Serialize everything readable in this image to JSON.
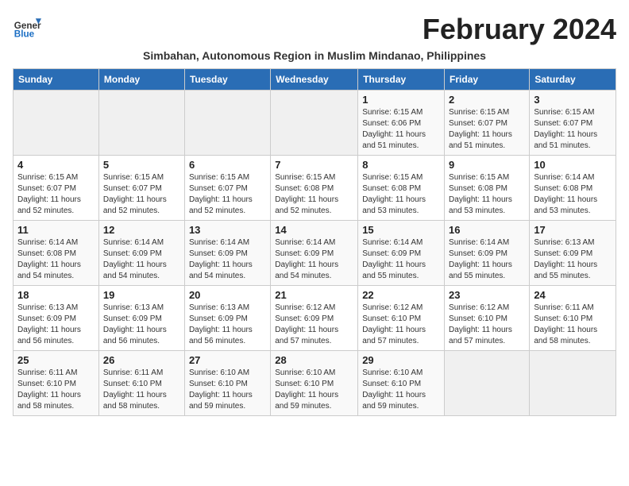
{
  "header": {
    "logo_general": "General",
    "logo_blue": "Blue",
    "month_title": "February 2024",
    "subtitle": "Simbahan, Autonomous Region in Muslim Mindanao, Philippines"
  },
  "days_of_week": [
    "Sunday",
    "Monday",
    "Tuesday",
    "Wednesday",
    "Thursday",
    "Friday",
    "Saturday"
  ],
  "weeks": [
    [
      {
        "day": "",
        "info": ""
      },
      {
        "day": "",
        "info": ""
      },
      {
        "day": "",
        "info": ""
      },
      {
        "day": "",
        "info": ""
      },
      {
        "day": "1",
        "info": "Sunrise: 6:15 AM\nSunset: 6:06 PM\nDaylight: 11 hours\nand 51 minutes."
      },
      {
        "day": "2",
        "info": "Sunrise: 6:15 AM\nSunset: 6:07 PM\nDaylight: 11 hours\nand 51 minutes."
      },
      {
        "day": "3",
        "info": "Sunrise: 6:15 AM\nSunset: 6:07 PM\nDaylight: 11 hours\nand 51 minutes."
      }
    ],
    [
      {
        "day": "4",
        "info": "Sunrise: 6:15 AM\nSunset: 6:07 PM\nDaylight: 11 hours\nand 52 minutes."
      },
      {
        "day": "5",
        "info": "Sunrise: 6:15 AM\nSunset: 6:07 PM\nDaylight: 11 hours\nand 52 minutes."
      },
      {
        "day": "6",
        "info": "Sunrise: 6:15 AM\nSunset: 6:07 PM\nDaylight: 11 hours\nand 52 minutes."
      },
      {
        "day": "7",
        "info": "Sunrise: 6:15 AM\nSunset: 6:08 PM\nDaylight: 11 hours\nand 52 minutes."
      },
      {
        "day": "8",
        "info": "Sunrise: 6:15 AM\nSunset: 6:08 PM\nDaylight: 11 hours\nand 53 minutes."
      },
      {
        "day": "9",
        "info": "Sunrise: 6:15 AM\nSunset: 6:08 PM\nDaylight: 11 hours\nand 53 minutes."
      },
      {
        "day": "10",
        "info": "Sunrise: 6:14 AM\nSunset: 6:08 PM\nDaylight: 11 hours\nand 53 minutes."
      }
    ],
    [
      {
        "day": "11",
        "info": "Sunrise: 6:14 AM\nSunset: 6:08 PM\nDaylight: 11 hours\nand 54 minutes."
      },
      {
        "day": "12",
        "info": "Sunrise: 6:14 AM\nSunset: 6:09 PM\nDaylight: 11 hours\nand 54 minutes."
      },
      {
        "day": "13",
        "info": "Sunrise: 6:14 AM\nSunset: 6:09 PM\nDaylight: 11 hours\nand 54 minutes."
      },
      {
        "day": "14",
        "info": "Sunrise: 6:14 AM\nSunset: 6:09 PM\nDaylight: 11 hours\nand 54 minutes."
      },
      {
        "day": "15",
        "info": "Sunrise: 6:14 AM\nSunset: 6:09 PM\nDaylight: 11 hours\nand 55 minutes."
      },
      {
        "day": "16",
        "info": "Sunrise: 6:14 AM\nSunset: 6:09 PM\nDaylight: 11 hours\nand 55 minutes."
      },
      {
        "day": "17",
        "info": "Sunrise: 6:13 AM\nSunset: 6:09 PM\nDaylight: 11 hours\nand 55 minutes."
      }
    ],
    [
      {
        "day": "18",
        "info": "Sunrise: 6:13 AM\nSunset: 6:09 PM\nDaylight: 11 hours\nand 56 minutes."
      },
      {
        "day": "19",
        "info": "Sunrise: 6:13 AM\nSunset: 6:09 PM\nDaylight: 11 hours\nand 56 minutes."
      },
      {
        "day": "20",
        "info": "Sunrise: 6:13 AM\nSunset: 6:09 PM\nDaylight: 11 hours\nand 56 minutes."
      },
      {
        "day": "21",
        "info": "Sunrise: 6:12 AM\nSunset: 6:09 PM\nDaylight: 11 hours\nand 57 minutes."
      },
      {
        "day": "22",
        "info": "Sunrise: 6:12 AM\nSunset: 6:10 PM\nDaylight: 11 hours\nand 57 minutes."
      },
      {
        "day": "23",
        "info": "Sunrise: 6:12 AM\nSunset: 6:10 PM\nDaylight: 11 hours\nand 57 minutes."
      },
      {
        "day": "24",
        "info": "Sunrise: 6:11 AM\nSunset: 6:10 PM\nDaylight: 11 hours\nand 58 minutes."
      }
    ],
    [
      {
        "day": "25",
        "info": "Sunrise: 6:11 AM\nSunset: 6:10 PM\nDaylight: 11 hours\nand 58 minutes."
      },
      {
        "day": "26",
        "info": "Sunrise: 6:11 AM\nSunset: 6:10 PM\nDaylight: 11 hours\nand 58 minutes."
      },
      {
        "day": "27",
        "info": "Sunrise: 6:10 AM\nSunset: 6:10 PM\nDaylight: 11 hours\nand 59 minutes."
      },
      {
        "day": "28",
        "info": "Sunrise: 6:10 AM\nSunset: 6:10 PM\nDaylight: 11 hours\nand 59 minutes."
      },
      {
        "day": "29",
        "info": "Sunrise: 6:10 AM\nSunset: 6:10 PM\nDaylight: 11 hours\nand 59 minutes."
      },
      {
        "day": "",
        "info": ""
      },
      {
        "day": "",
        "info": ""
      }
    ]
  ]
}
